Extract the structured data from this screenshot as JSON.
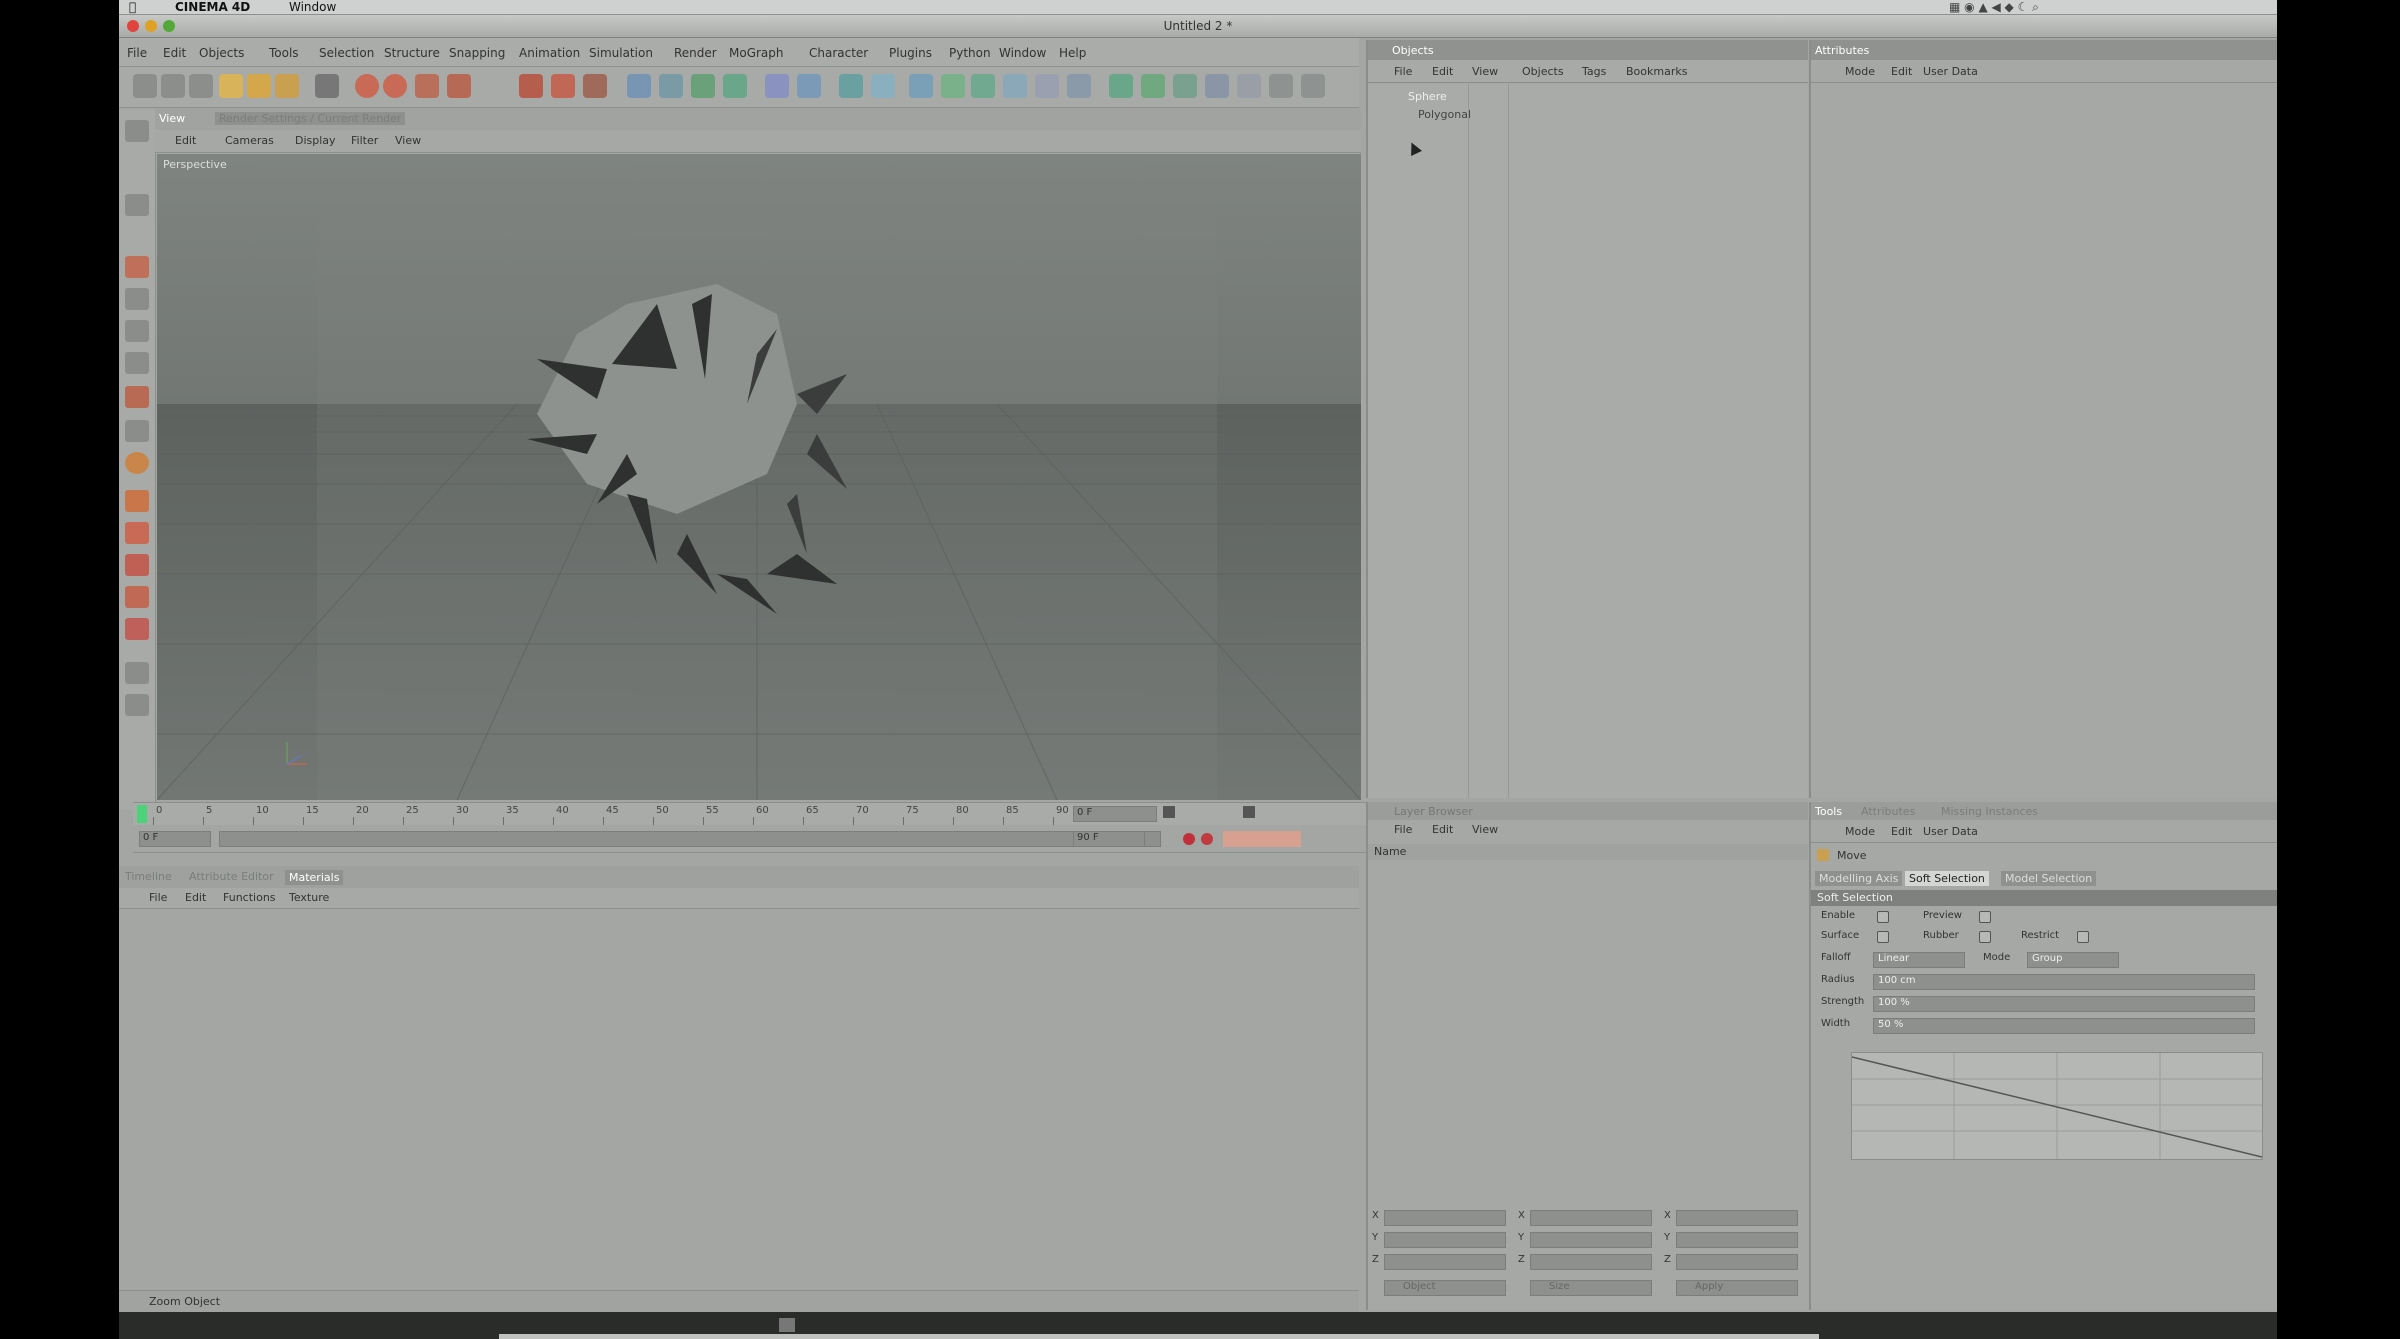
{
  "app_name": "CINEMA 4D",
  "app_menu": "Window",
  "window_title": "Untitled 2 *",
  "menu": [
    "File",
    "Edit",
    "Objects",
    "Tools",
    "Selection",
    "Structure",
    "Snapping",
    "Animation",
    "Simulation",
    "Render",
    "MoGraph",
    "Character",
    "Plugins",
    "Python",
    "Window",
    "Help"
  ],
  "viewport": {
    "tab_label": "View",
    "tab_hint": "Render Settings / Current Render",
    "menu": [
      "Edit",
      "Cameras",
      "Display",
      "Filter",
      "View"
    ],
    "label": "Perspective"
  },
  "objects_panel": {
    "title": "Objects",
    "menu": [
      "File",
      "Edit",
      "View",
      "Objects",
      "Tags",
      "Bookmarks"
    ],
    "items": [
      "Sphere",
      "Polygonal"
    ]
  },
  "attributes_panel": {
    "title": "Attributes",
    "menu": [
      "Mode",
      "Edit",
      "User Data"
    ]
  },
  "timeline": {
    "ticks": [
      "0",
      "5",
      "10",
      "15",
      "20",
      "25",
      "30",
      "35",
      "40",
      "45",
      "50",
      "55",
      "60",
      "65",
      "70",
      "75",
      "80",
      "85",
      "90"
    ],
    "current": "0 F",
    "end": "90 F",
    "start_field": "0 F",
    "end_field": "90 F"
  },
  "material_panel": {
    "tabs": [
      "Timeline",
      "Attribute Editor",
      "Materials"
    ],
    "menu": [
      "File",
      "Edit",
      "Functions",
      "Texture"
    ]
  },
  "layer_panel": {
    "title": "Layer Browser",
    "menu": [
      "File",
      "Edit",
      "View"
    ],
    "name_label": "Name",
    "coord_rows": [
      "X",
      "Y",
      "Z"
    ],
    "bottom_buttons": [
      "Object",
      "Size",
      "Apply"
    ]
  },
  "tool_panel": {
    "tabs": [
      "Tools",
      "Attributes",
      "Missing Instances"
    ],
    "menu": [
      "Mode",
      "Edit",
      "User Data"
    ],
    "tool_name": "Move",
    "subtabs": [
      "Modelling Axis",
      "Soft Selection",
      "Model Selection"
    ],
    "section": "Soft Selection",
    "fields": [
      {
        "label": "Enable",
        "type": "check"
      },
      {
        "label": "Preview",
        "type": "check"
      },
      {
        "label": "Surface",
        "type": "check"
      },
      {
        "label": "Rubber",
        "type": "check"
      },
      {
        "label": "Restrict",
        "type": "check"
      },
      {
        "label": "Falloff",
        "value": "Linear"
      },
      {
        "label": "Mode",
        "value": "Group"
      },
      {
        "label": "Radius",
        "value": "100 cm"
      },
      {
        "label": "Strength",
        "value": "100 %"
      },
      {
        "label": "Width",
        "value": "50 %"
      }
    ]
  },
  "status_text": "Zoom Object"
}
